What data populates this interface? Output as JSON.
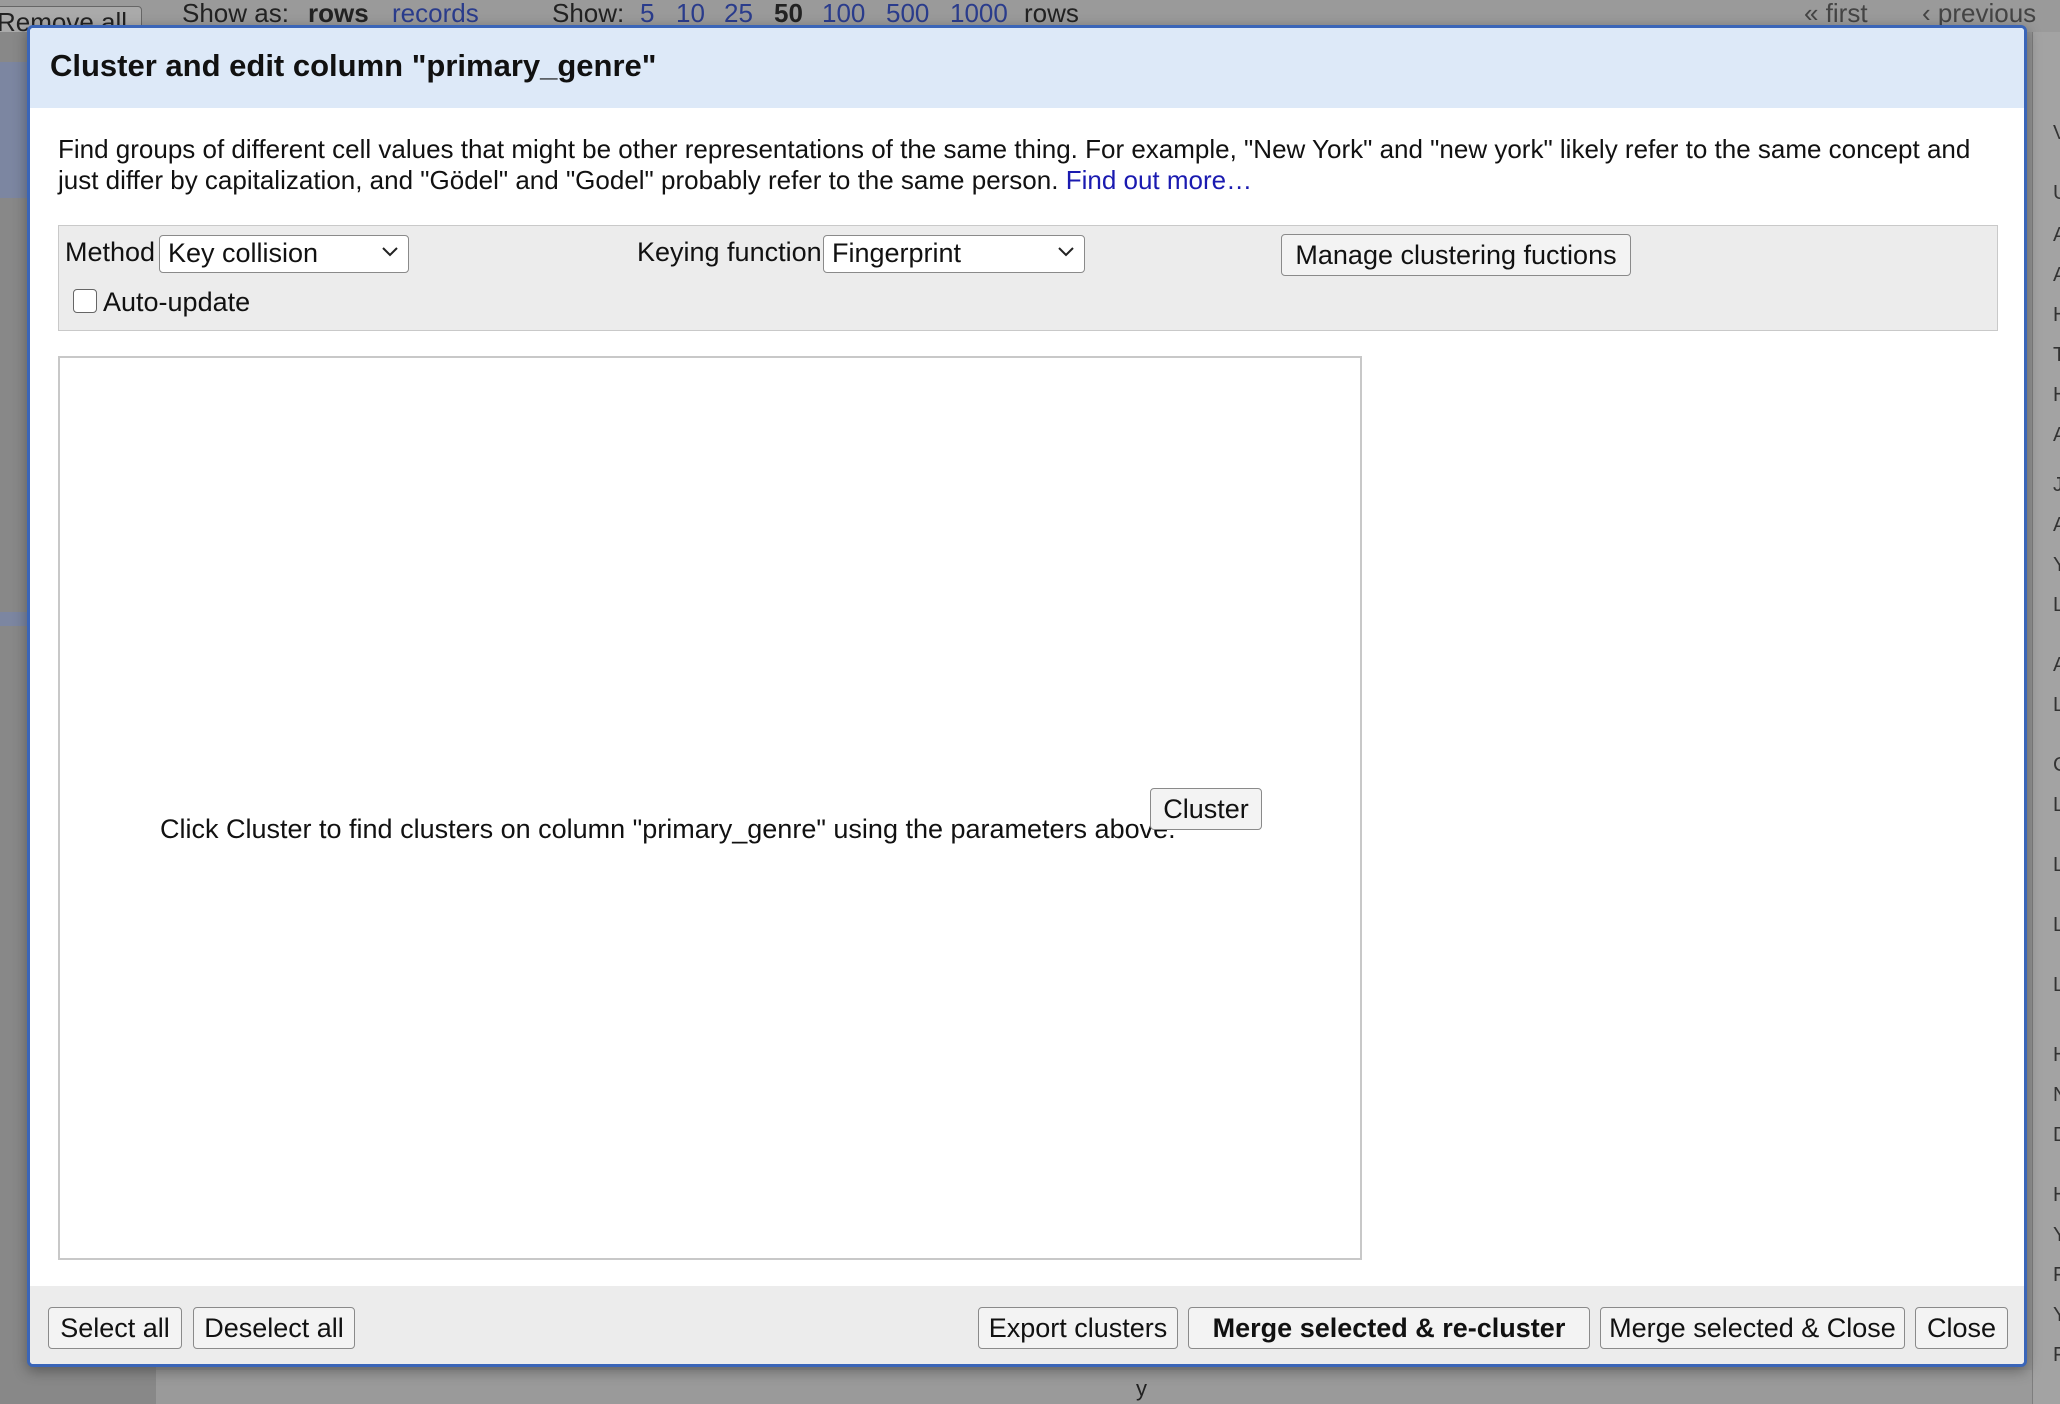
{
  "background": {
    "remove_all_label": "Remove all",
    "show_as_label": "Show as:",
    "show_as_rows": "rows",
    "show_as_records": "records",
    "show_label": "Show:",
    "page_sizes": [
      "5",
      "10",
      "25",
      "50",
      "100",
      "500",
      "1000"
    ],
    "page_size_selected": "50",
    "rows_suffix": "rows",
    "first_link": "« first",
    "previous_link": "‹ previous",
    "right_column_letters": [
      "V",
      "U",
      "A",
      "A",
      "H",
      "T",
      "H",
      "A",
      "J",
      "A",
      "Y",
      "L",
      "A",
      "L",
      "C",
      "L",
      "L",
      "L",
      "L",
      "H",
      "N",
      "D",
      "H",
      "Y",
      "F",
      "Y",
      "F"
    ],
    "bottom_cell_text": "y"
  },
  "dialog": {
    "title": "Cluster and edit column \"primary_genre\"",
    "description": "Find groups of different cell values that might be other representations of the same thing. For example, \"New York\" and \"new york\" likely refer to the same concept and just differ by capitalization, and \"Gödel\" and \"Godel\" probably refer to the same person.",
    "find_out_more_link": "Find out more…",
    "method_label": "Method",
    "method_value": "Key collision",
    "keying_function_label": "Keying function",
    "keying_function_value": "Fingerprint",
    "manage_button": "Manage clustering fuctions",
    "auto_update_label": "Auto-update",
    "auto_update_checked": false,
    "cluster_prompt": "Click Cluster to find clusters on column \"primary_genre\" using the parameters above.",
    "cluster_button": "Cluster"
  },
  "footer": {
    "select_all": "Select all",
    "deselect_all": "Deselect all",
    "export_clusters": "Export clusters",
    "merge_recluster": "Merge selected & re-cluster",
    "merge_close": "Merge selected & Close",
    "close": "Close"
  }
}
